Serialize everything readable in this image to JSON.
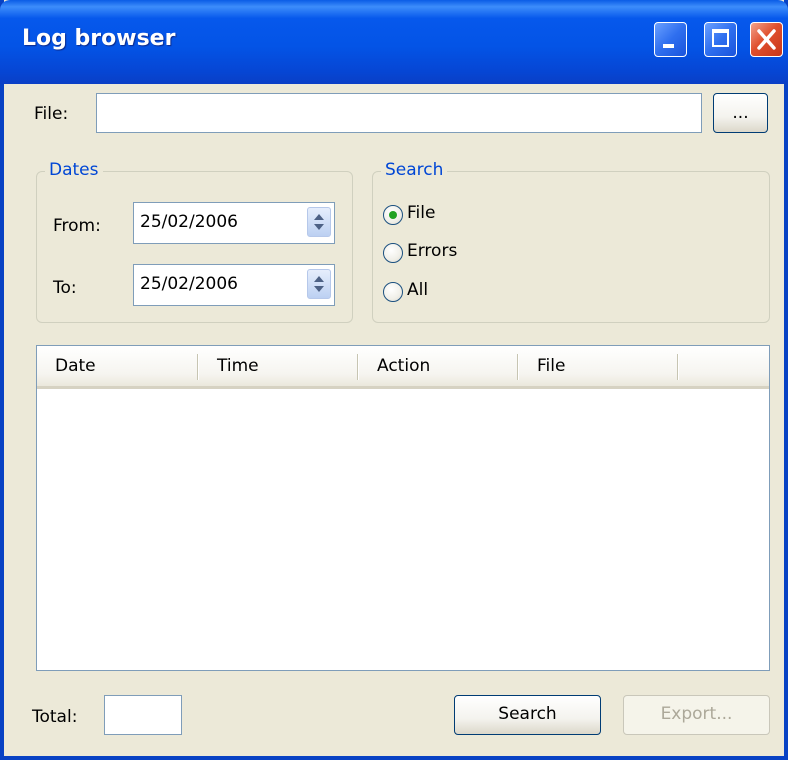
{
  "window": {
    "title": "Log browser"
  },
  "file": {
    "label": "File:",
    "value": "",
    "browse_label": "..."
  },
  "dates": {
    "group_title": "Dates",
    "from_label": "From:",
    "from_value": "25/02/2006",
    "to_label": "To:",
    "to_value": "25/02/2006"
  },
  "search": {
    "group_title": "Search",
    "options": [
      {
        "label": "File",
        "selected": true
      },
      {
        "label": "Errors",
        "selected": false
      },
      {
        "label": "All",
        "selected": false
      }
    ]
  },
  "table": {
    "columns": [
      "Date",
      "Time",
      "Action",
      "File"
    ],
    "rows": []
  },
  "footer": {
    "total_label": "Total:",
    "total_value": "",
    "search_button": "Search",
    "export_button": "Export..."
  },
  "colors": {
    "titlebar": "#0454e6",
    "window_bg": "#ece9d8",
    "group_title": "#0046d5",
    "radio_dot": "#21a121"
  }
}
